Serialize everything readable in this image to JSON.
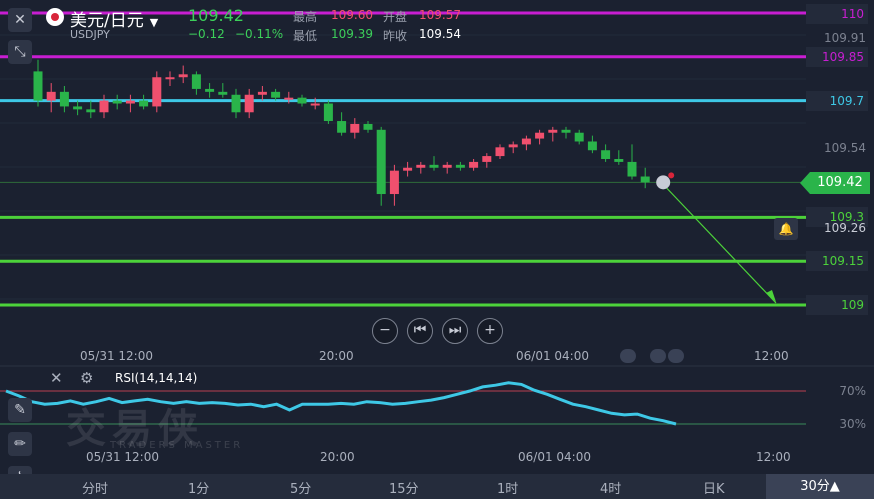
{
  "header": {
    "title": "美元/日元",
    "symbol": "USDJPY",
    "price": "109.42",
    "change": "−0.12",
    "change_pct": "−0.11%",
    "high_label": "最高",
    "high_value": "109.60",
    "open_label": "开盘",
    "open_value": "109.57",
    "low_label": "最低",
    "low_value": "109.39",
    "prev_close_label": "昨收",
    "prev_close_value": "109.54"
  },
  "levels": [
    {
      "label": "110",
      "price": 110,
      "color": "#c81ed2"
    },
    {
      "label": "109.85",
      "price": 109.85,
      "color": "#c81ed2"
    },
    {
      "label": "109.7",
      "price": 109.7,
      "color": "#3ec8e6"
    },
    {
      "label": "109.3",
      "price": 109.3,
      "color": "#4cd23a"
    },
    {
      "label": "109.15",
      "price": 109.15,
      "color": "#4cd23a"
    },
    {
      "label": "109",
      "price": 109,
      "color": "#4cd23a"
    }
  ],
  "axis_labels": [
    {
      "text": "109.91",
      "price": 109.91
    },
    {
      "text": "109.54",
      "price": 109.54
    },
    {
      "text": "109.26",
      "price": 109.26
    }
  ],
  "current_price_tag": "109.42",
  "time_axis": [
    "05/31 12:00",
    "20:00",
    "06/01 04:00",
    "12:00"
  ],
  "rsi": {
    "label": "RSI(14,14,14)",
    "levels": [
      "70%",
      "30%"
    ]
  },
  "timeframes": [
    "分时",
    "1分",
    "5分",
    "15分",
    "1时",
    "4时",
    "日K"
  ],
  "active_timeframe": "30分▲",
  "watermark": "交易侠",
  "watermark_sub": "TRADERS MASTER",
  "chart_data": {
    "type": "candlestick",
    "title": "美元/日元 USDJPY 30分",
    "ylim": [
      108.94,
      110.02
    ],
    "candles": [
      {
        "o": 109.8,
        "h": 109.84,
        "l": 109.68,
        "c": 109.7
      },
      {
        "o": 109.7,
        "h": 109.76,
        "l": 109.66,
        "c": 109.73
      },
      {
        "o": 109.73,
        "h": 109.75,
        "l": 109.66,
        "c": 109.68
      },
      {
        "o": 109.68,
        "h": 109.7,
        "l": 109.65,
        "c": 109.67
      },
      {
        "o": 109.67,
        "h": 109.7,
        "l": 109.64,
        "c": 109.66
      },
      {
        "o": 109.66,
        "h": 109.72,
        "l": 109.64,
        "c": 109.7
      },
      {
        "o": 109.7,
        "h": 109.72,
        "l": 109.67,
        "c": 109.69
      },
      {
        "o": 109.69,
        "h": 109.72,
        "l": 109.66,
        "c": 109.7
      },
      {
        "o": 109.7,
        "h": 109.72,
        "l": 109.67,
        "c": 109.68
      },
      {
        "o": 109.68,
        "h": 109.8,
        "l": 109.66,
        "c": 109.78
      },
      {
        "o": 109.78,
        "h": 109.8,
        "l": 109.75,
        "c": 109.78
      },
      {
        "o": 109.78,
        "h": 109.82,
        "l": 109.76,
        "c": 109.79
      },
      {
        "o": 109.79,
        "h": 109.8,
        "l": 109.72,
        "c": 109.74
      },
      {
        "o": 109.74,
        "h": 109.76,
        "l": 109.71,
        "c": 109.73
      },
      {
        "o": 109.73,
        "h": 109.76,
        "l": 109.71,
        "c": 109.72
      },
      {
        "o": 109.72,
        "h": 109.74,
        "l": 109.64,
        "c": 109.66
      },
      {
        "o": 109.66,
        "h": 109.74,
        "l": 109.64,
        "c": 109.72
      },
      {
        "o": 109.72,
        "h": 109.75,
        "l": 109.7,
        "c": 109.73
      },
      {
        "o": 109.73,
        "h": 109.74,
        "l": 109.7,
        "c": 109.71
      },
      {
        "o": 109.71,
        "h": 109.73,
        "l": 109.69,
        "c": 109.71
      },
      {
        "o": 109.71,
        "h": 109.72,
        "l": 109.68,
        "c": 109.69
      },
      {
        "o": 109.69,
        "h": 109.71,
        "l": 109.67,
        "c": 109.69
      },
      {
        "o": 109.69,
        "h": 109.7,
        "l": 109.62,
        "c": 109.63
      },
      {
        "o": 109.63,
        "h": 109.66,
        "l": 109.58,
        "c": 109.59
      },
      {
        "o": 109.59,
        "h": 109.64,
        "l": 109.57,
        "c": 109.62
      },
      {
        "o": 109.62,
        "h": 109.63,
        "l": 109.59,
        "c": 109.6
      },
      {
        "o": 109.6,
        "h": 109.61,
        "l": 109.34,
        "c": 109.38
      },
      {
        "o": 109.38,
        "h": 109.48,
        "l": 109.34,
        "c": 109.46
      },
      {
        "o": 109.46,
        "h": 109.49,
        "l": 109.44,
        "c": 109.47
      },
      {
        "o": 109.47,
        "h": 109.49,
        "l": 109.45,
        "c": 109.48
      },
      {
        "o": 109.48,
        "h": 109.51,
        "l": 109.46,
        "c": 109.47
      },
      {
        "o": 109.47,
        "h": 109.49,
        "l": 109.45,
        "c": 109.48
      },
      {
        "o": 109.48,
        "h": 109.49,
        "l": 109.46,
        "c": 109.47
      },
      {
        "o": 109.47,
        "h": 109.5,
        "l": 109.46,
        "c": 109.49
      },
      {
        "o": 109.49,
        "h": 109.52,
        "l": 109.47,
        "c": 109.51
      },
      {
        "o": 109.51,
        "h": 109.55,
        "l": 109.5,
        "c": 109.54
      },
      {
        "o": 109.54,
        "h": 109.56,
        "l": 109.52,
        "c": 109.55
      },
      {
        "o": 109.55,
        "h": 109.58,
        "l": 109.53,
        "c": 109.57
      },
      {
        "o": 109.57,
        "h": 109.6,
        "l": 109.55,
        "c": 109.59
      },
      {
        "o": 109.59,
        "h": 109.61,
        "l": 109.56,
        "c": 109.6
      },
      {
        "o": 109.6,
        "h": 109.61,
        "l": 109.57,
        "c": 109.59
      },
      {
        "o": 109.59,
        "h": 109.6,
        "l": 109.55,
        "c": 109.56
      },
      {
        "o": 109.56,
        "h": 109.58,
        "l": 109.52,
        "c": 109.53
      },
      {
        "o": 109.53,
        "h": 109.55,
        "l": 109.49,
        "c": 109.5
      },
      {
        "o": 109.5,
        "h": 109.53,
        "l": 109.48,
        "c": 109.49
      },
      {
        "o": 109.49,
        "h": 109.55,
        "l": 109.43,
        "c": 109.44
      },
      {
        "o": 109.44,
        "h": 109.47,
        "l": 109.4,
        "c": 109.42
      }
    ],
    "rsi_values": [
      70,
      64,
      57,
      54,
      55,
      58,
      54,
      57,
      61,
      56,
      58,
      60,
      57,
      55,
      57,
      55,
      56,
      55,
      53,
      54,
      51,
      54,
      47,
      54,
      54,
      54,
      55,
      54,
      57,
      56,
      54,
      55,
      57,
      59,
      62,
      66,
      70,
      75,
      77,
      80,
      78,
      71,
      66,
      60,
      54,
      51,
      47,
      43,
      41,
      42,
      37,
      34,
      30
    ]
  }
}
